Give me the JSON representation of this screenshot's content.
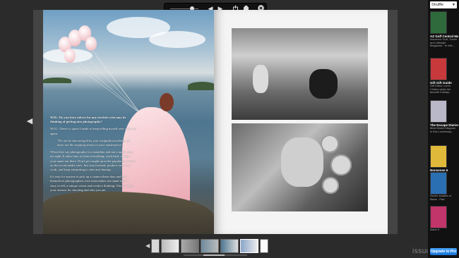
{
  "viewer": {
    "controls": {
      "prev_icon": "previous-page-icon",
      "next_icon": "next-page-icon",
      "zoom_icon": "zoom-slider-icon",
      "share_icon": "share-icon",
      "print_icon": "print-icon",
      "close_icon": "close-icon"
    },
    "article": {
      "question": "WSL: Do you have advice for any newbies who may be thinking of getting into photography?",
      "answer_intro": "WLG: There's a quote I made to keep telling myself over and over again:",
      "pull_quote": "\"Do not be discouraged by your insignificant photos, for these are the stepping-stones to your masterpiece\"",
      "body_1": "When they say photography is a marathon and not a sprint, they are right. It takes time to learn everything, work hard, and get your name out there. Don't get caught up in the popularity contest on the social media sites. Just stay focused, produce your best work, and keep submitting to sites and sharing.",
      "body_2": "It's easy for anyone to pick up a camera these days and call themselves photographers, but what makes one stand out is a story to tell, a unique vision and creative thinking. Always know your reasons for shooting and who you are."
    }
  },
  "thumbnails": {
    "count": 7,
    "active_index": 4
  },
  "branding": {
    "logo_text": "issuu"
  },
  "sidebar": {
    "dropdown_value": "Shuffle",
    "publications": [
      {
        "title": "AZ Golf Central Magazine",
        "desc": "Arizona's Golf, Travel and Lifestyle Magazine - In this...",
        "color": "#2f6a3c"
      },
      {
        "title": "Gift Gift Guide",
        "desc": "Gift Editor Loren Chides picks her favorite holiday...",
        "color": "#c8393c"
      },
      {
        "title": "The Escape Diaries",
        "desc": "Meet Maxie Magunn in this Lovelessly...",
        "color": "#b8b8c8"
      },
      {
        "title": "Nonsense 5",
        "desc": "",
        "color": "#e1b93a"
      },
      {
        "title": "",
        "desc": "Seven shades of Black - Part",
        "color": "#2b6fb3"
      },
      {
        "title": "",
        "desc": "Issue 3",
        "color": "#c2356a"
      }
    ],
    "upgrade_label": "Upgrade to Pro"
  }
}
